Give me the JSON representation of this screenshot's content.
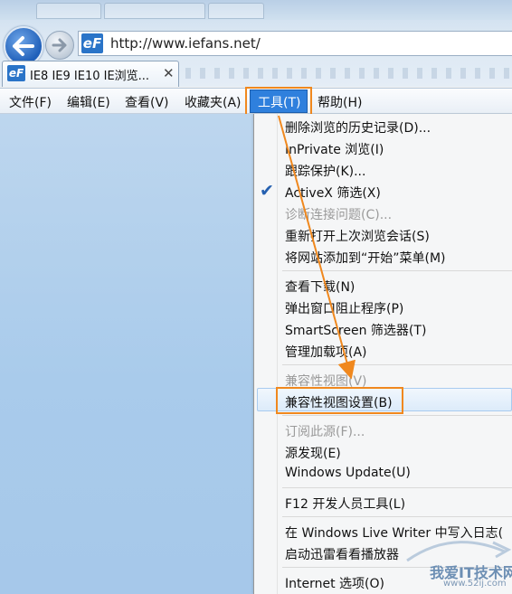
{
  "address": {
    "url": "http://www.iefans.net/",
    "site_logo": "eF"
  },
  "tab": {
    "title": "IE8 IE9 IE10 IE浏览...",
    "favicon": "eF",
    "close": "✕"
  },
  "menubar": {
    "items": [
      "文件(F)",
      "编辑(E)",
      "查看(V)",
      "收藏夹(A)",
      "工具(T)",
      "帮助(H)"
    ],
    "active": "工具(T)"
  },
  "tools_menu": {
    "group1": [
      "删除浏览的历史记录(D)...",
      "InPrivate 浏览(I)",
      "跟踪保护(K)...",
      "ActiveX 筛选(X)",
      "诊断连接问题(C)...",
      "重新打开上次浏览会话(S)",
      "将网站添加到“开始”菜单(M)"
    ],
    "group2": [
      "查看下载(N)",
      "弹出窗口阻止程序(P)",
      "SmartScreen 筛选器(T)",
      "管理加载项(A)"
    ],
    "group3": [
      "兼容性视图(V)",
      "兼容性视图设置(B)"
    ],
    "group4": [
      "订阅此源(F)...",
      "源发现(E)",
      "Windows Update(U)"
    ],
    "group5": [
      "F12 开发人员工具(L)"
    ],
    "group6": [
      "在 Windows Live Writer 中写入日志(",
      "启动迅雷看看播放器"
    ],
    "group7": [
      "Internet 选项(O)"
    ],
    "checked": "ActiveX 筛选(X)",
    "highlighted": "兼容性视图设置(B)"
  },
  "watermark": {
    "text": "我爱IT技术网",
    "url": "www.52ij.com"
  },
  "colors": {
    "highlight_box": "#f0881e",
    "menu_active": "#2f80dd",
    "page_bg": "#a9cbeb"
  },
  "icons": [
    "back-arrow-icon",
    "forward-arrow-icon",
    "checkmark-icon",
    "close-icon"
  ]
}
